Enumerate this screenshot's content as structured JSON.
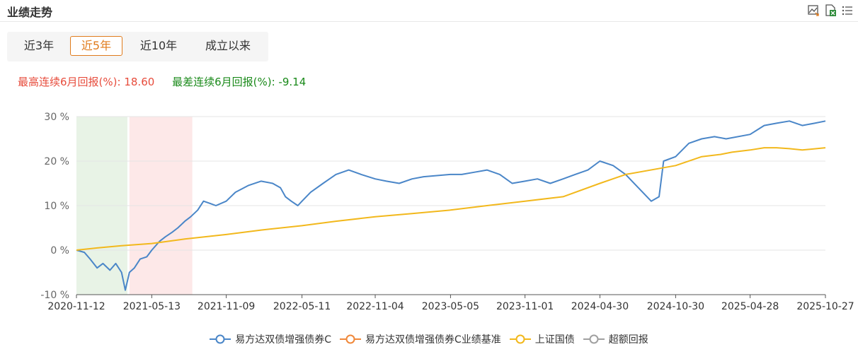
{
  "header": {
    "title": "业绩走势"
  },
  "tabs": [
    {
      "label": "近3年",
      "active": false
    },
    {
      "label": "近5年",
      "active": true
    },
    {
      "label": "近10年",
      "active": false
    },
    {
      "label": "成立以来",
      "active": false
    }
  ],
  "stats": {
    "best_label": "最高连续6月回报(%):",
    "best_value": "18.60",
    "worst_label": "最差连续6月回报(%):",
    "worst_value": "-9.14"
  },
  "icons": [
    "image-download-icon",
    "excel-export-icon",
    "list-icon"
  ],
  "colors": {
    "fund": "#4a86c8",
    "benchmark": "#f0883a",
    "bond_index": "#f2b81c",
    "excess": "#a0a0a0",
    "green_band": "#e8f3e6",
    "red_band": "#fde8e8",
    "accent": "#e07b1c"
  },
  "chart_data": {
    "type": "line",
    "y_tick_labels": [
      "30 %",
      "20 %",
      "10 %",
      "0 %",
      "-10 %"
    ],
    "ylim": [
      -10,
      30
    ],
    "x_tick_labels": [
      "2020-11-12",
      "2021-05-13",
      "2021-11-09",
      "2022-05-11",
      "2022-11-04",
      "2023-05-05",
      "2023-11-01",
      "2024-04-30",
      "2024-10-30",
      "2025-04-28",
      "2025-10-27"
    ],
    "xlim": [
      "2020-11-12",
      "2025-10-27"
    ],
    "highlight_bands": [
      {
        "from": "2020-11-12",
        "to": "2021-03-15",
        "color": "green"
      },
      {
        "from": "2021-03-20",
        "to": "2021-08-19",
        "color": "red"
      }
    ],
    "grid": "horizontal",
    "legend_position": "bottom-center",
    "series": [
      {
        "name": "易方达双债增强债券C",
        "points": [
          [
            "2020-11-12",
            0
          ],
          [
            "2020-12-01",
            -0.5
          ],
          [
            "2020-12-15",
            -2
          ],
          [
            "2021-01-01",
            -4
          ],
          [
            "2021-01-15",
            -3
          ],
          [
            "2021-02-01",
            -4.5
          ],
          [
            "2021-02-15",
            -3
          ],
          [
            "2021-03-01",
            -5
          ],
          [
            "2021-03-10",
            -9
          ],
          [
            "2021-03-20",
            -5
          ],
          [
            "2021-04-01",
            -4
          ],
          [
            "2021-04-15",
            -2
          ],
          [
            "2021-05-01",
            -1.5
          ],
          [
            "2021-05-13",
            0
          ],
          [
            "2021-06-01",
            2
          ],
          [
            "2021-06-15",
            3
          ],
          [
            "2021-07-01",
            4
          ],
          [
            "2021-07-15",
            5
          ],
          [
            "2021-08-01",
            6.5
          ],
          [
            "2021-08-15",
            7.5
          ],
          [
            "2021-09-01",
            9
          ],
          [
            "2021-09-15",
            11
          ],
          [
            "2021-10-01",
            10.5
          ],
          [
            "2021-10-15",
            10
          ],
          [
            "2021-11-09",
            11
          ],
          [
            "2021-12-01",
            13
          ],
          [
            "2022-01-01",
            14.5
          ],
          [
            "2022-02-01",
            15.5
          ],
          [
            "2022-03-01",
            15
          ],
          [
            "2022-03-20",
            14
          ],
          [
            "2022-04-01",
            12
          ],
          [
            "2022-04-15",
            11
          ],
          [
            "2022-05-01",
            10
          ],
          [
            "2022-05-11",
            11
          ],
          [
            "2022-06-01",
            13
          ],
          [
            "2022-07-01",
            15
          ],
          [
            "2022-08-01",
            17
          ],
          [
            "2022-09-01",
            18
          ],
          [
            "2022-10-01",
            17
          ],
          [
            "2022-11-04",
            16
          ],
          [
            "2022-12-01",
            15.5
          ],
          [
            "2023-01-01",
            15
          ],
          [
            "2023-02-01",
            16
          ],
          [
            "2023-03-01",
            16.5
          ],
          [
            "2023-05-05",
            17
          ],
          [
            "2023-06-01",
            17
          ],
          [
            "2023-07-01",
            17.5
          ],
          [
            "2023-08-01",
            18
          ],
          [
            "2023-09-01",
            17
          ],
          [
            "2023-10-01",
            15
          ],
          [
            "2023-11-01",
            15.5
          ],
          [
            "2023-12-01",
            16
          ],
          [
            "2024-01-01",
            15
          ],
          [
            "2024-02-01",
            16
          ],
          [
            "2024-03-01",
            17
          ],
          [
            "2024-04-01",
            18
          ],
          [
            "2024-04-30",
            20
          ],
          [
            "2024-06-01",
            19
          ],
          [
            "2024-07-01",
            17
          ],
          [
            "2024-08-01",
            14
          ],
          [
            "2024-09-01",
            11
          ],
          [
            "2024-09-20",
            12
          ],
          [
            "2024-10-01",
            20
          ],
          [
            "2024-10-30",
            21
          ],
          [
            "2024-12-01",
            24
          ],
          [
            "2025-01-01",
            25
          ],
          [
            "2025-02-01",
            25.5
          ],
          [
            "2025-03-01",
            25
          ],
          [
            "2025-04-28",
            26
          ],
          [
            "2025-05-15",
            27
          ],
          [
            "2025-06-01",
            28
          ],
          [
            "2025-07-01",
            28.5
          ],
          [
            "2025-08-01",
            29
          ],
          [
            "2025-09-01",
            28
          ],
          [
            "2025-10-01",
            28.5
          ],
          [
            "2025-10-27",
            29
          ]
        ]
      },
      {
        "name": "易方达双债增强债券C业绩基准",
        "points": []
      },
      {
        "name": "上证国债",
        "points": [
          [
            "2020-11-12",
            0
          ],
          [
            "2021-01-01",
            0.5
          ],
          [
            "2021-03-01",
            1
          ],
          [
            "2021-05-13",
            1.5
          ],
          [
            "2021-08-01",
            2.5
          ],
          [
            "2021-11-09",
            3.5
          ],
          [
            "2022-02-01",
            4.5
          ],
          [
            "2022-05-11",
            5.5
          ],
          [
            "2022-08-01",
            6.5
          ],
          [
            "2022-11-04",
            7.5
          ],
          [
            "2023-02-01",
            8.2
          ],
          [
            "2023-05-05",
            9
          ],
          [
            "2023-08-01",
            10
          ],
          [
            "2023-11-01",
            11
          ],
          [
            "2024-02-01",
            12
          ],
          [
            "2024-04-30",
            15
          ],
          [
            "2024-07-01",
            17
          ],
          [
            "2024-10-30",
            19
          ],
          [
            "2025-01-01",
            21
          ],
          [
            "2025-02-15",
            21.5
          ],
          [
            "2025-03-15",
            22
          ],
          [
            "2025-04-28",
            22.5
          ],
          [
            "2025-06-01",
            23
          ],
          [
            "2025-07-01",
            23
          ],
          [
            "2025-08-01",
            22.8
          ],
          [
            "2025-09-01",
            22.5
          ],
          [
            "2025-10-27",
            23
          ]
        ]
      },
      {
        "name": "超额回报",
        "points": []
      }
    ]
  }
}
